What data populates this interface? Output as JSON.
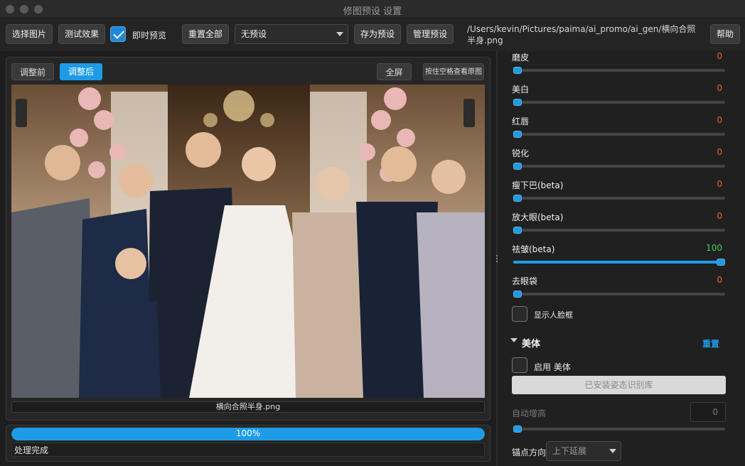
{
  "window": {
    "title": "修图预设 设置"
  },
  "toolbar": {
    "select_image": "选择图片",
    "test_effect": "测试效果",
    "live_preview_label": "即时预览",
    "live_preview_checked": true,
    "reset_all": "重置全部",
    "preset_value": "无预设",
    "save_preset": "存为预设",
    "manage_preset": "管理预设",
    "file_path": "/Users/kevin/Pictures/paima/ai_promo/ai_gen/横向合照半身.png",
    "help": "帮助"
  },
  "preview": {
    "tab_before": "调整前",
    "tab_after": "调整后",
    "active_tab": "调整后",
    "fullscreen": "全屏",
    "hold_space": "按住空格查看原图",
    "file_name": "横向合照半身.png"
  },
  "progress": {
    "percent_label": "100%",
    "value": 1.0,
    "status": "处理完成"
  },
  "sliders": [
    {
      "name": "磨皮",
      "value": "0",
      "fraction": 0.0,
      "color": "#ff5a3c"
    },
    {
      "name": "美白",
      "value": "0",
      "fraction": 0.0,
      "color": "#ff5a3c"
    },
    {
      "name": "红唇",
      "value": "0",
      "fraction": 0.0,
      "color": "#ff5a3c"
    },
    {
      "name": "锐化",
      "value": "0",
      "fraction": 0.0,
      "color": "#ff5a3c"
    },
    {
      "name": "瘦下巴(beta)",
      "value": "0",
      "fraction": 0.0,
      "color": "#ff5a3c"
    },
    {
      "name": "放大眼(beta)",
      "value": "0",
      "fraction": 0.0,
      "color": "#ff5a3c"
    },
    {
      "name": "祛皱(beta)",
      "value": "100",
      "fraction": 1.0,
      "color": "#3cd25a"
    },
    {
      "name": "去眼袋",
      "value": "0",
      "fraction": 0.0,
      "color": "#ff5a3c"
    }
  ],
  "face_box": {
    "label": "显示人脸框",
    "checked": false
  },
  "body_section": {
    "title": "美体",
    "reset": "重置",
    "enable_label": "启用 美体",
    "enable_checked": false,
    "pose_button": "已安装姿态识别库",
    "auto_height_label": "自动增高",
    "auto_height_value": "0",
    "auto_height_fraction": 0.0,
    "anchor_label": "锚点方向",
    "anchor_value": "上下延展"
  }
}
